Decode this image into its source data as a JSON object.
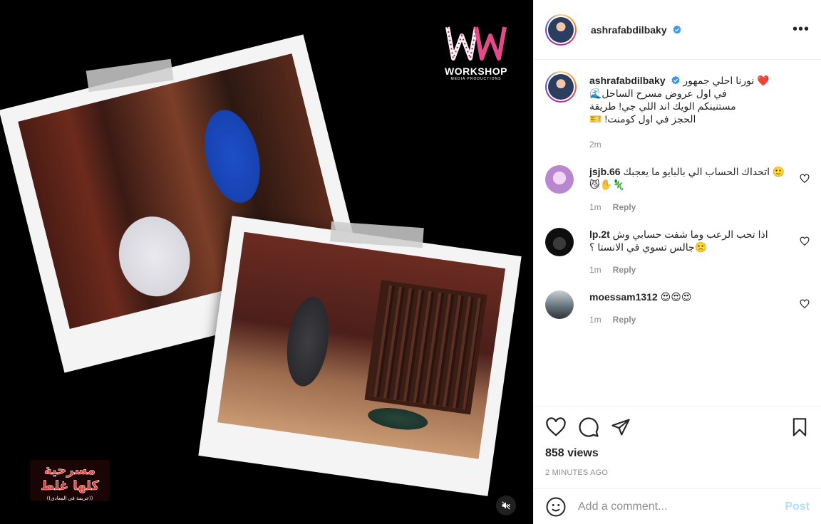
{
  "post": {
    "username": "ashrafabdilbaky",
    "more_label": "•••",
    "caption_lines": [
      "نورنا احلي جمهور ❤️",
      "في اول عروض مسرح الساحل🌊",
      "مستنينكم الويك اند اللي جي! طريقة",
      "الحجز في اول كومنت! 🎫"
    ],
    "caption_time": "2m",
    "views": "858 views",
    "posted_ago": "2 MINUTES AGO"
  },
  "media": {
    "workshop_logo": "WORKSHOP",
    "workshop_sub": "MEDIA PRODUCTIONS",
    "show_logo_line1": "مسرحية",
    "show_logo_line2": "كلها غلط",
    "show_logo_sub": "((جريمة في المعادي))"
  },
  "comments": [
    {
      "user": "jsjb.66",
      "text": "اتحداك الحساب الي بالبايو ما يعجبك 🙂😼✋🦎",
      "time": "1m",
      "reply": "Reply",
      "avatar_color": "#c9a3d9"
    },
    {
      "user": "lp.2t",
      "text": "اذا تحب الرعب وما شفت حسابي وش جالس تسوي في الانستا ؟🙁",
      "time": "1m",
      "reply": "Reply",
      "avatar_color": "#1a1a1a"
    },
    {
      "user": "moessam1312",
      "text": "😍😍😍",
      "time": "1m",
      "reply": "Reply",
      "avatar_color": "#5f6b74"
    }
  ],
  "comment_box": {
    "placeholder": "Add a comment...",
    "post_label": "Post"
  },
  "colors": {
    "verified": "#3897f0",
    "post_disabled": "#b2dffc",
    "secondary_text": "#8e8e8e"
  },
  "icons": [
    "heart-icon",
    "comment-icon",
    "share-icon",
    "bookmark-icon",
    "emoji-icon",
    "mute-icon",
    "verified-badge-icon",
    "more-options-icon"
  ]
}
